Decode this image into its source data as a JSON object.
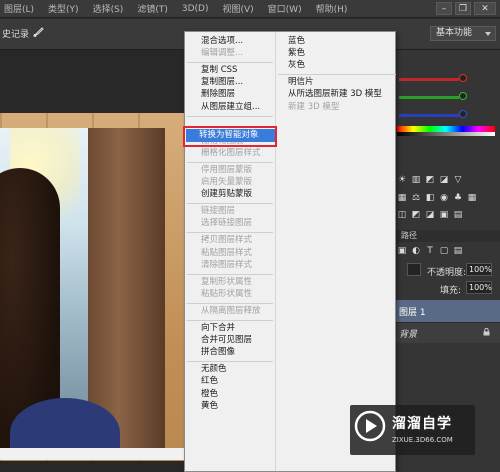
{
  "menubar": {
    "items": [
      "图层(L)",
      "类型(Y)",
      "选择(S)",
      "滤镜(T)",
      "3D(D)",
      "视图(V)",
      "窗口(W)",
      "帮助(H)"
    ]
  },
  "options_bar": {
    "history_label": "史记录",
    "workspace": "基本功能"
  },
  "right_panel": {
    "paths_tab": "路径",
    "opacity_label": "不透明度:",
    "opacity_value": "100%",
    "fill_label": "填充:",
    "fill_value": "100%",
    "layer1_name": "图层 1",
    "background_name": "背景",
    "slider_colors": [
      "#e03030",
      "#30c030",
      "#3050e0"
    ]
  },
  "context_menu": {
    "col1": [
      {
        "label": "混合选项...",
        "enabled": true
      },
      {
        "label": "编辑调整...",
        "enabled": false
      },
      {
        "sep": true
      },
      {
        "label": "复制 CSS",
        "enabled": true
      },
      {
        "label": "复制图层...",
        "enabled": true
      },
      {
        "label": "删除图层",
        "enabled": true
      },
      {
        "label": "从图层建立组...",
        "enabled": true
      },
      {
        "sep": true
      },
      {
        "label": "转换为智能对象",
        "enabled": true,
        "highlighted": true
      },
      {
        "sep": true
      },
      {
        "label": "栅格化图层",
        "enabled": false
      },
      {
        "label": "栅格化图层样式",
        "enabled": false
      },
      {
        "sep": true
      },
      {
        "label": "停用图层蒙版",
        "enabled": false
      },
      {
        "label": "启用矢量蒙版",
        "enabled": false
      },
      {
        "label": "创建剪贴蒙版",
        "enabled": true
      },
      {
        "sep": true
      },
      {
        "label": "链接图层",
        "enabled": false
      },
      {
        "label": "选择链接图层",
        "enabled": false
      },
      {
        "sep": true
      },
      {
        "label": "拷贝图层样式",
        "enabled": false
      },
      {
        "label": "粘贴图层样式",
        "enabled": false
      },
      {
        "label": "清除图层样式",
        "enabled": false
      },
      {
        "sep": true
      },
      {
        "label": "复制形状属性",
        "enabled": false
      },
      {
        "label": "粘贴形状属性",
        "enabled": false
      },
      {
        "sep": true
      },
      {
        "label": "从隔离图层释放",
        "enabled": false
      },
      {
        "sep": true
      },
      {
        "label": "向下合并",
        "enabled": true
      },
      {
        "label": "合并可见图层",
        "enabled": true
      },
      {
        "label": "拼合图像",
        "enabled": true
      },
      {
        "sep": true
      },
      {
        "label": "无颜色",
        "enabled": true
      },
      {
        "label": "红色",
        "enabled": true
      },
      {
        "label": "橙色",
        "enabled": true
      },
      {
        "label": "黄色",
        "enabled": true
      }
    ],
    "col2": [
      {
        "label": "蓝色",
        "enabled": true
      },
      {
        "label": "紫色",
        "enabled": true
      },
      {
        "label": "灰色",
        "enabled": true
      },
      {
        "sep": true
      },
      {
        "label": "明信片",
        "enabled": true
      },
      {
        "label": "从所选图层新建 3D 模型",
        "enabled": true
      },
      {
        "label": "新建 3D 模型",
        "enabled": false
      }
    ]
  },
  "watermark": {
    "title": "溜溜自学",
    "url": "ZIXUE.3D66.COM"
  }
}
